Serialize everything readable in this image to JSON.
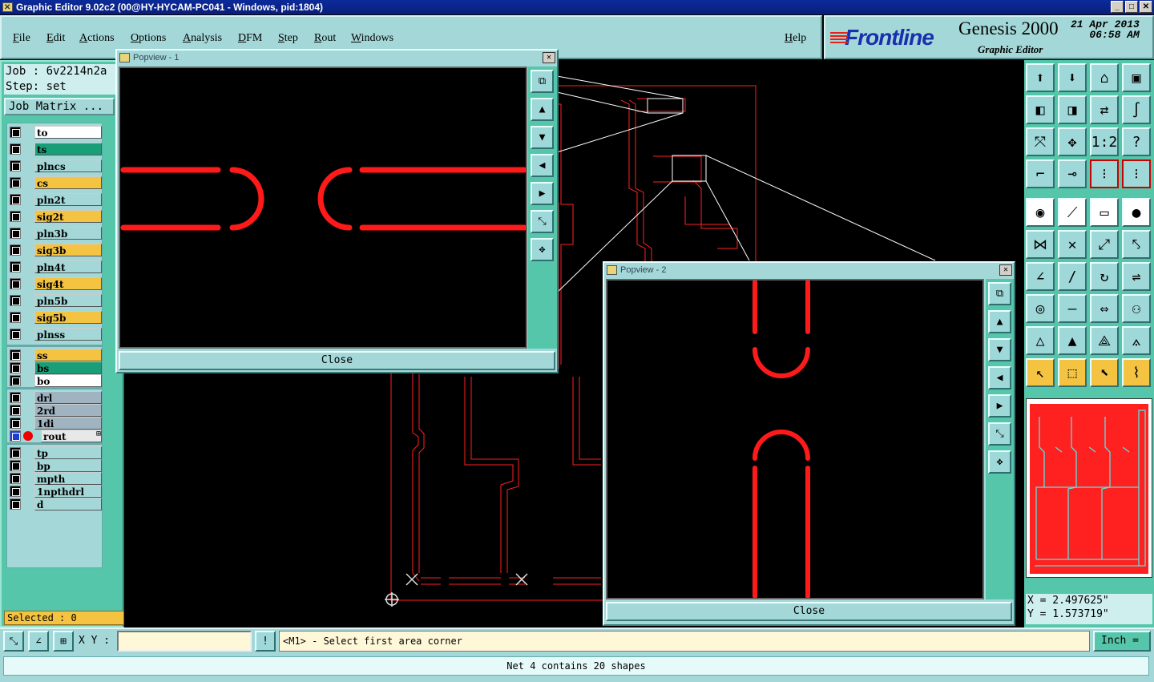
{
  "window": {
    "title": "Graphic Editor 9.02c2 (00@HY-HYCAM-PC041 - Windows, pid:1804)",
    "min": "_",
    "max": "□",
    "close": "✕"
  },
  "menu": [
    "File",
    "Edit",
    "Actions",
    "Options",
    "Analysis",
    "DFM",
    "Step",
    "Rout",
    "Windows"
  ],
  "help": "Help",
  "brand": {
    "logo": "Frontline",
    "product": "Genesis 2000",
    "subtitle": "Graphic Editor",
    "date": "21 Apr 2013",
    "time": "06:58 AM"
  },
  "job": {
    "job_line": "Job : 6v2214n2a",
    "step_line": "Step: set",
    "matrix_button": "Job Matrix ..."
  },
  "layers": [
    {
      "name": "to",
      "color": "#ffffff"
    },
    {
      "name": "ts",
      "color": "#1a9e78"
    },
    {
      "name": "plncs",
      "color": "#a4d8d8"
    },
    {
      "name": "cs",
      "color": "#f5c342"
    },
    {
      "name": "pln2t",
      "color": "#a4d8d8"
    },
    {
      "name": "sig2t",
      "color": "#f5c342"
    },
    {
      "name": "pln3b",
      "color": "#a4d8d8"
    },
    {
      "name": "sig3b",
      "color": "#f5c342"
    },
    {
      "name": "pln4t",
      "color": "#a4d8d8"
    },
    {
      "name": "sig4t",
      "color": "#f5c342"
    },
    {
      "name": "pln5b",
      "color": "#a4d8d8"
    },
    {
      "name": "sig5b",
      "color": "#f5c342"
    },
    {
      "name": "plnss",
      "color": "#a4d8d8"
    },
    {
      "name": "ss",
      "color": "#f5c342"
    },
    {
      "name": "bs",
      "color": "#1a9e78"
    },
    {
      "name": "bo",
      "color": "#ffffff"
    },
    {
      "name": "drl",
      "color": "#9fb3c0"
    },
    {
      "name": "2rd",
      "color": "#9fb3c0"
    },
    {
      "name": "1di",
      "color": "#9fb3c0"
    },
    {
      "name": "rout",
      "color": "#e8e8e8",
      "active": true,
      "mark": "⊞"
    },
    {
      "name": "tp",
      "color": "#a4d8d8"
    },
    {
      "name": "bp",
      "color": "#a4d8d8"
    },
    {
      "name": "mpth",
      "color": "#a4d8d8"
    },
    {
      "name": "1npthdrl",
      "color": "#a4d8d8"
    },
    {
      "name": "d",
      "color": "#a4d8d8"
    }
  ],
  "selected": "Selected : 0",
  "popview1": {
    "title": "Popview - 1",
    "close": "Close"
  },
  "popview2": {
    "title": "Popview - 2",
    "close": "Close"
  },
  "coords": {
    "x": "X = 2.497625\"",
    "y": "Y = 1.573719\""
  },
  "bottom": {
    "xy_label": "X Y :",
    "xy_value": "",
    "info": "!",
    "prompt": "<M1> - Select first area corner",
    "unit": "Inch ="
  },
  "status": "Net 4 contains 20 shapes",
  "colors": {
    "rout": "#ff0000",
    "panel": "#55c6a9",
    "bg": "#000000"
  }
}
